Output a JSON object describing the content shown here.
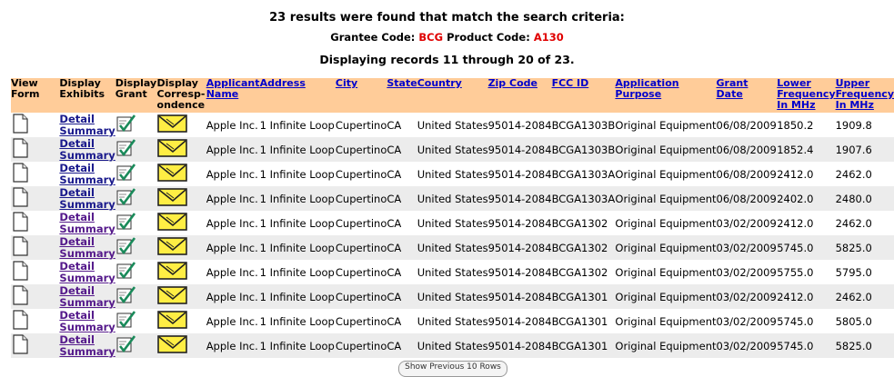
{
  "summary": {
    "count_line": "23 results were found that match the search criteria:",
    "grantee_label": "Grantee Code:",
    "grantee_code": "BCG",
    "product_label": "Product Code:",
    "product_code": "A130",
    "display_line": "Displaying records 11 through 20 of 23."
  },
  "columns": {
    "view_form": "View Form",
    "display_exhibits": "Display Exhibits",
    "display_grant": "Display Grant",
    "display_corr": "Display Correspondence",
    "applicant": "Applicant Name",
    "address": "Address",
    "city": "City",
    "state": "State",
    "country": "Country",
    "zip": "Zip Code",
    "fcc_id": "FCC ID",
    "purpose": "Application Purpose",
    "grant_date": "Grant Date",
    "lower": "Lower Frequency In MHz",
    "upper": "Upper Frequency In MHz"
  },
  "detail_text_1": "Detail",
  "detail_text_2": "Summary",
  "rows": [
    {
      "applicant": "Apple Inc.",
      "address": "1 Infinite Loop",
      "city": "Cupertino",
      "state": "CA",
      "country": "United States",
      "zip": "95014-2084",
      "fcc_id": "BCGA1303B",
      "purpose": "Original Equipment",
      "grant_date": "06/08/2009",
      "lower": "1850.2",
      "upper": "1909.8"
    },
    {
      "applicant": "Apple Inc.",
      "address": "1 Infinite Loop",
      "city": "Cupertino",
      "state": "CA",
      "country": "United States",
      "zip": "95014-2084",
      "fcc_id": "BCGA1303B",
      "purpose": "Original Equipment",
      "grant_date": "06/08/2009",
      "lower": "1852.4",
      "upper": "1907.6"
    },
    {
      "applicant": "Apple Inc.",
      "address": "1 Infinite Loop",
      "city": "Cupertino",
      "state": "CA",
      "country": "United States",
      "zip": "95014-2084",
      "fcc_id": "BCGA1303A",
      "purpose": "Original Equipment",
      "grant_date": "06/08/2009",
      "lower": "2412.0",
      "upper": "2462.0"
    },
    {
      "applicant": "Apple Inc.",
      "address": "1 Infinite Loop",
      "city": "Cupertino",
      "state": "CA",
      "country": "United States",
      "zip": "95014-2084",
      "fcc_id": "BCGA1303A",
      "purpose": "Original Equipment",
      "grant_date": "06/08/2009",
      "lower": "2402.0",
      "upper": "2480.0"
    },
    {
      "applicant": "Apple Inc.",
      "address": "1 Infinite Loop",
      "city": "Cupertino",
      "state": "CA",
      "country": "United States",
      "zip": "95014-2084",
      "fcc_id": "BCGA1302",
      "purpose": "Original Equipment",
      "grant_date": "03/02/2009",
      "lower": "2412.0",
      "upper": "2462.0"
    },
    {
      "applicant": "Apple Inc.",
      "address": "1 Infinite Loop",
      "city": "Cupertino",
      "state": "CA",
      "country": "United States",
      "zip": "95014-2084",
      "fcc_id": "BCGA1302",
      "purpose": "Original Equipment",
      "grant_date": "03/02/2009",
      "lower": "5745.0",
      "upper": "5825.0"
    },
    {
      "applicant": "Apple Inc.",
      "address": "1 Infinite Loop",
      "city": "Cupertino",
      "state": "CA",
      "country": "United States",
      "zip": "95014-2084",
      "fcc_id": "BCGA1302",
      "purpose": "Original Equipment",
      "grant_date": "03/02/2009",
      "lower": "5755.0",
      "upper": "5795.0"
    },
    {
      "applicant": "Apple Inc.",
      "address": "1 Infinite Loop",
      "city": "Cupertino",
      "state": "CA",
      "country": "United States",
      "zip": "95014-2084",
      "fcc_id": "BCGA1301",
      "purpose": "Original Equipment",
      "grant_date": "03/02/2009",
      "lower": "2412.0",
      "upper": "2462.0"
    },
    {
      "applicant": "Apple Inc.",
      "address": "1 Infinite Loop",
      "city": "Cupertino",
      "state": "CA",
      "country": "United States",
      "zip": "95014-2084",
      "fcc_id": "BCGA1301",
      "purpose": "Original Equipment",
      "grant_date": "03/02/2009",
      "lower": "5745.0",
      "upper": "5805.0"
    },
    {
      "applicant": "Apple Inc.",
      "address": "1 Infinite Loop",
      "city": "Cupertino",
      "state": "CA",
      "country": "United States",
      "zip": "95014-2084",
      "fcc_id": "BCGA1301",
      "purpose": "Original Equipment",
      "grant_date": "03/02/2009",
      "lower": "5745.0",
      "upper": "5825.0"
    }
  ],
  "pager_button": "Show Previous 10 Rows",
  "icons": {
    "view_form": "document-icon",
    "display_grant": "certificate-check-icon",
    "display_corr": "envelope-icon"
  },
  "colors": {
    "header_bg": "#ffcc99",
    "alt_row_bg": "#ececec",
    "code_red": "#e00000",
    "link_blue": "#0000cc"
  }
}
